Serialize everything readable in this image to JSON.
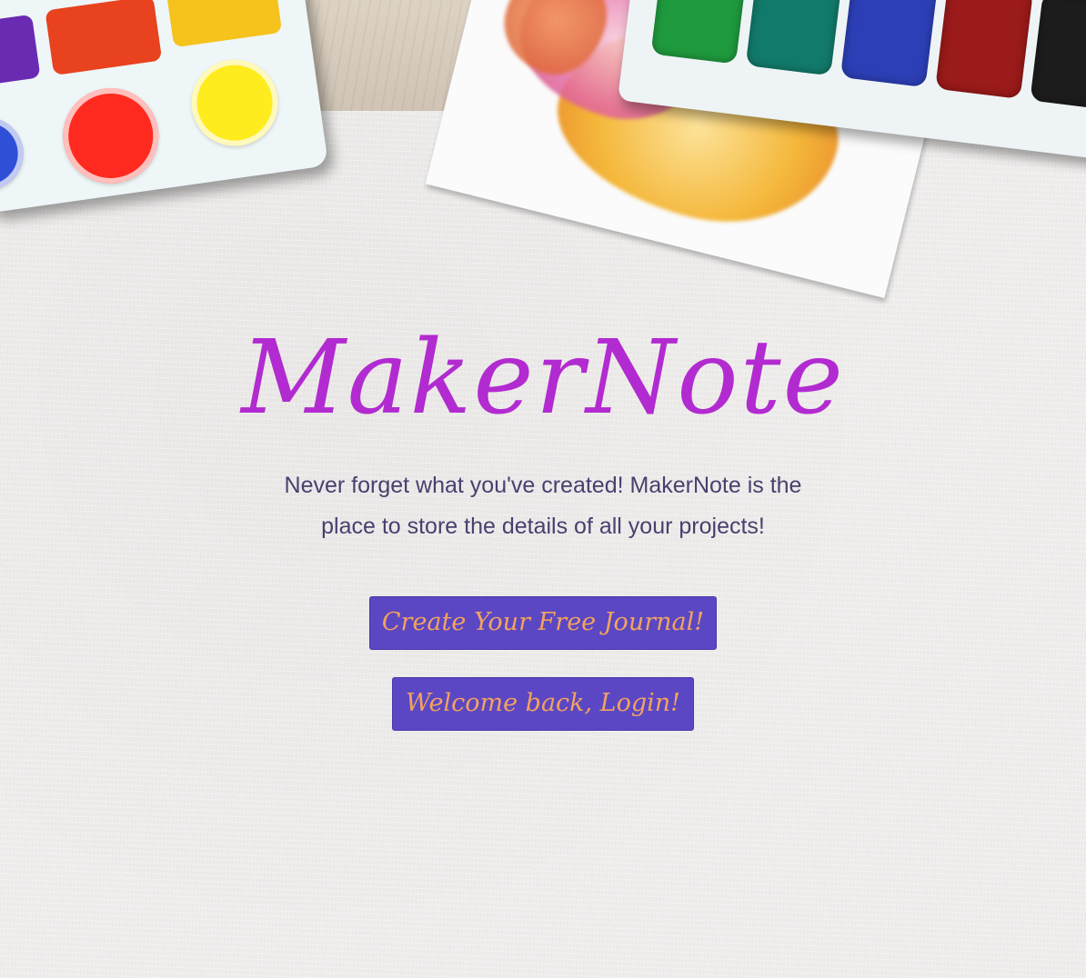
{
  "brand": {
    "title": "MakerNote",
    "title_color": "#b22bd0"
  },
  "hero": {
    "tagline": "Never forget what you've created! MakerNote is the place to store the details of all your projects!",
    "tagline_color": "#4a3f6e"
  },
  "actions": {
    "create_label": "Create Your Free Journal!",
    "login_label": "Welcome back, Login!",
    "button_bg": "#5b47c4",
    "button_text": "#f2a35e"
  },
  "decor": {
    "header_art": "watercolor-palettes-and-painted-card",
    "palette_left_colors": [
      "#e8321e",
      "#f6c21c",
      "#ff2a1f",
      "#ffec1f",
      "#2f4fd6",
      "#6a2bb3"
    ],
    "palette_right_colors": [
      "#1f9a3e",
      "#127a6a",
      "#2c3fb6",
      "#9b1a1a",
      "#1c1c1c"
    ],
    "card_blot_colors": [
      "#f2c13a",
      "#e76aa8",
      "#e56b3a",
      "#f4a324"
    ]
  }
}
